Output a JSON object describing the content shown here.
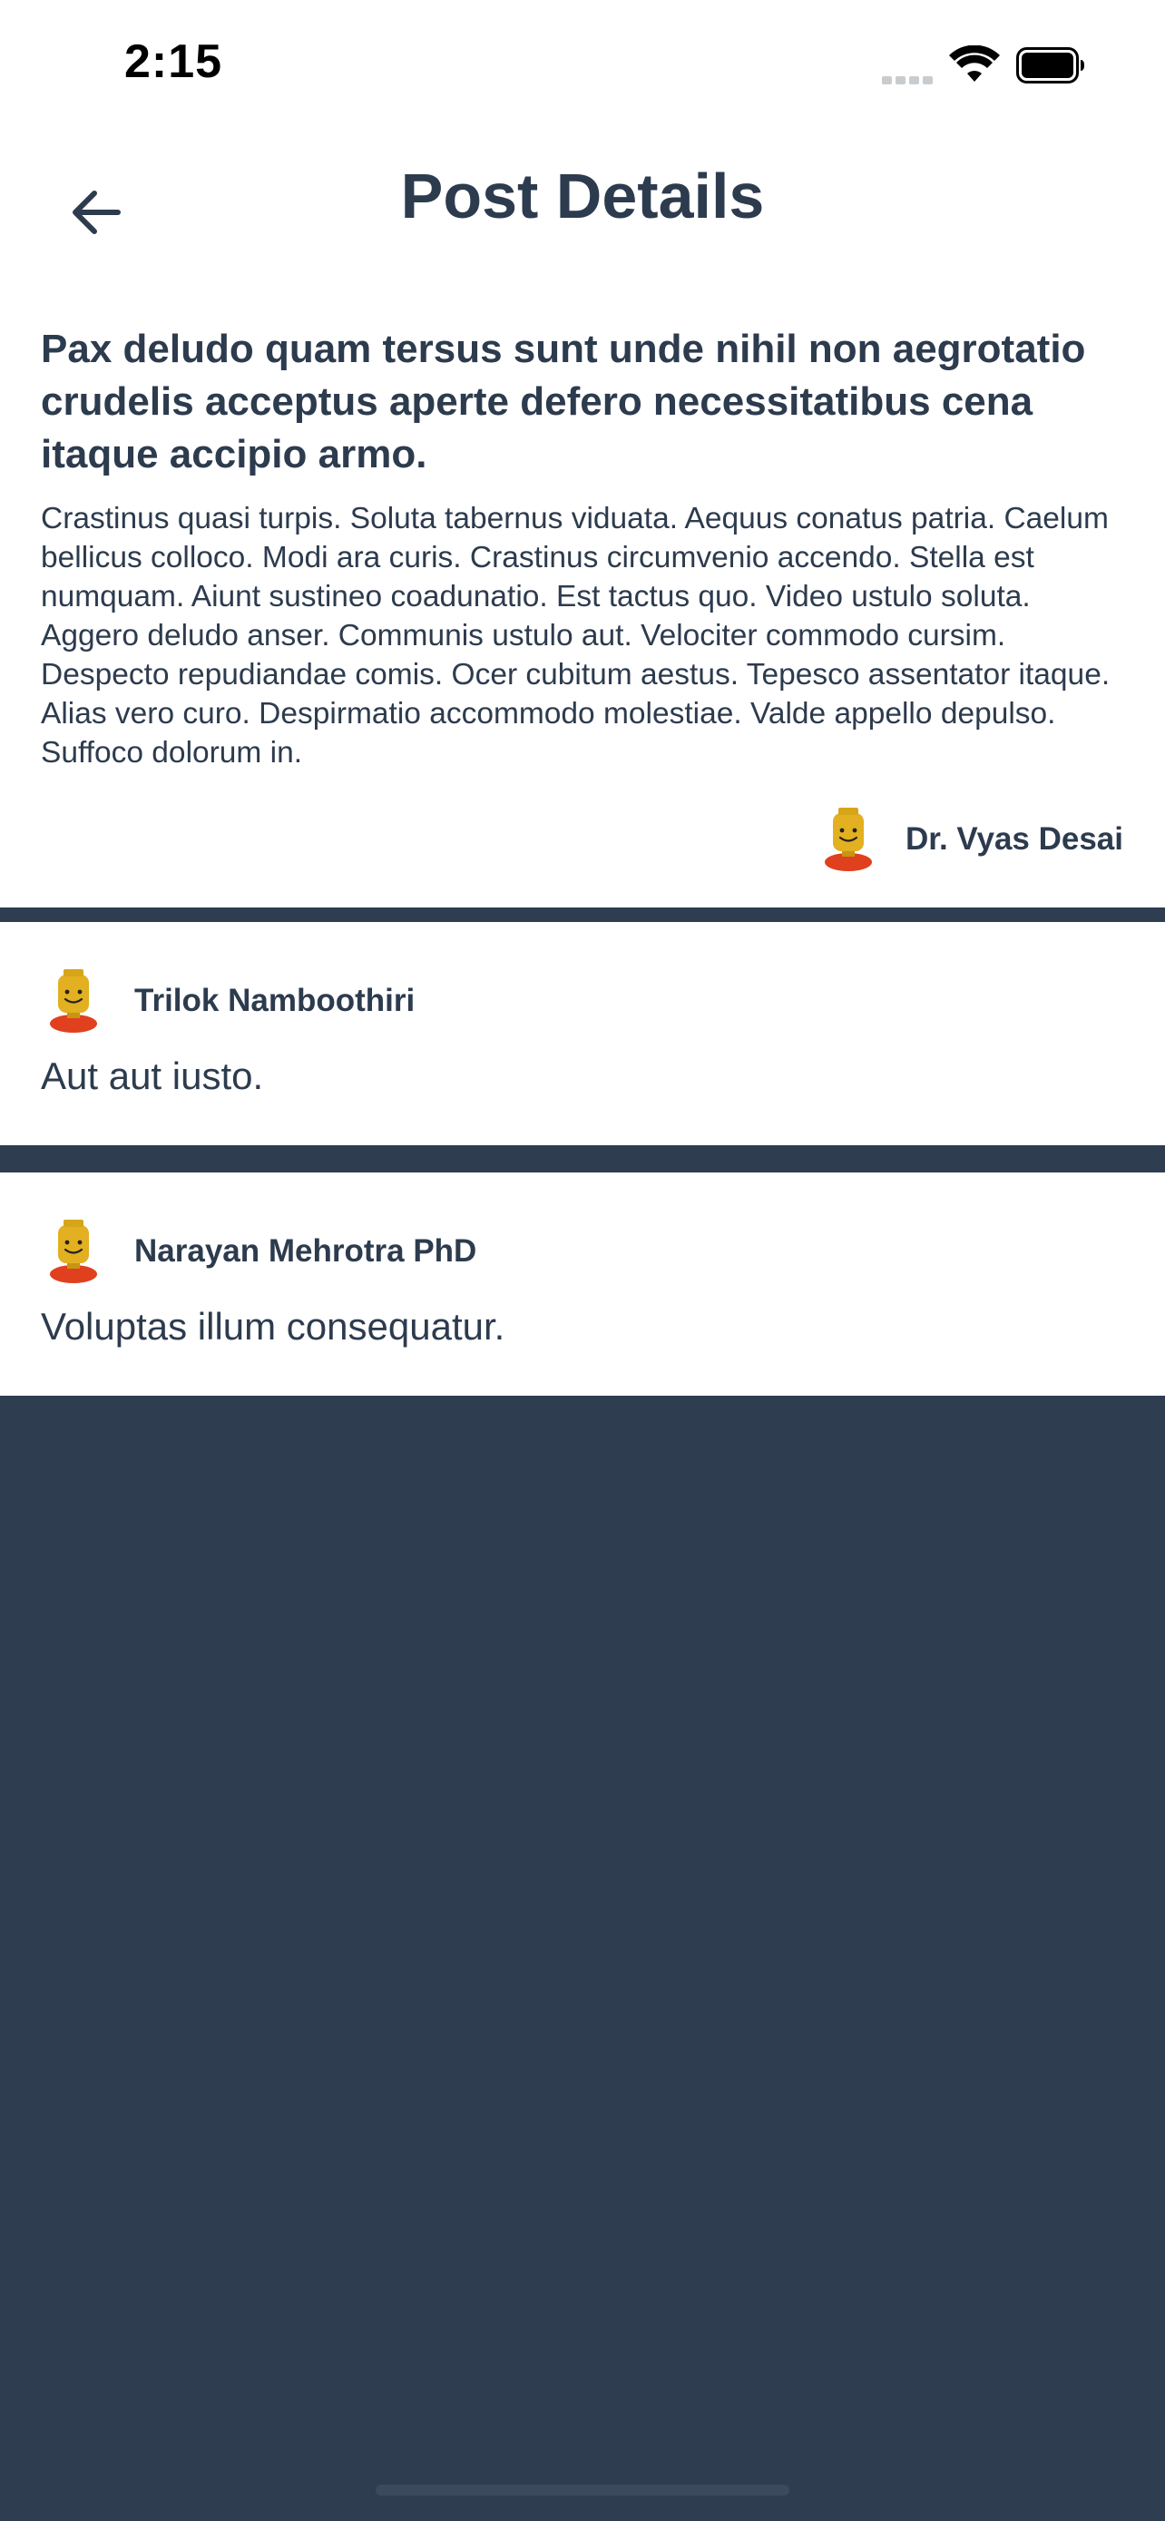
{
  "status_bar": {
    "time": "2:15"
  },
  "header": {
    "title": "Post Details",
    "back_icon": "arrow-left-icon"
  },
  "post": {
    "title": "Pax deludo quam tersus sunt unde nihil non aegrotatio crudelis acceptus aperte defero necessitatibus cena itaque accipio armo.",
    "body": "Crastinus quasi turpis. Soluta tabernus viduata. Aequus conatus patria. Caelum bellicus colloco. Modi ara curis. Crastinus circumvenio accendo. Stella est numquam. Aiunt sustineo coadunatio. Est tactus quo. Video ustulo soluta. Aggero deludo anser. Communis ustulo aut. Velociter commodo cursim. Despecto repudiandae comis. Ocer cubitum aestus. Tepesco assentator itaque. Alias vero curo. Despirmatio accommodo molestiae. Valde appello depulso. Suffoco dolorum in.",
    "author": "Dr. Vyas Desai"
  },
  "comments": [
    {
      "author": "Trilok Namboothiri",
      "text": "Aut aut iusto."
    },
    {
      "author": "Narayan Mehrotra PhD",
      "text": "Voluptas illum consequatur."
    }
  ],
  "colors": {
    "text": "#2d3b4e",
    "background_dark": "#2e3d50",
    "surface": "#ffffff"
  }
}
